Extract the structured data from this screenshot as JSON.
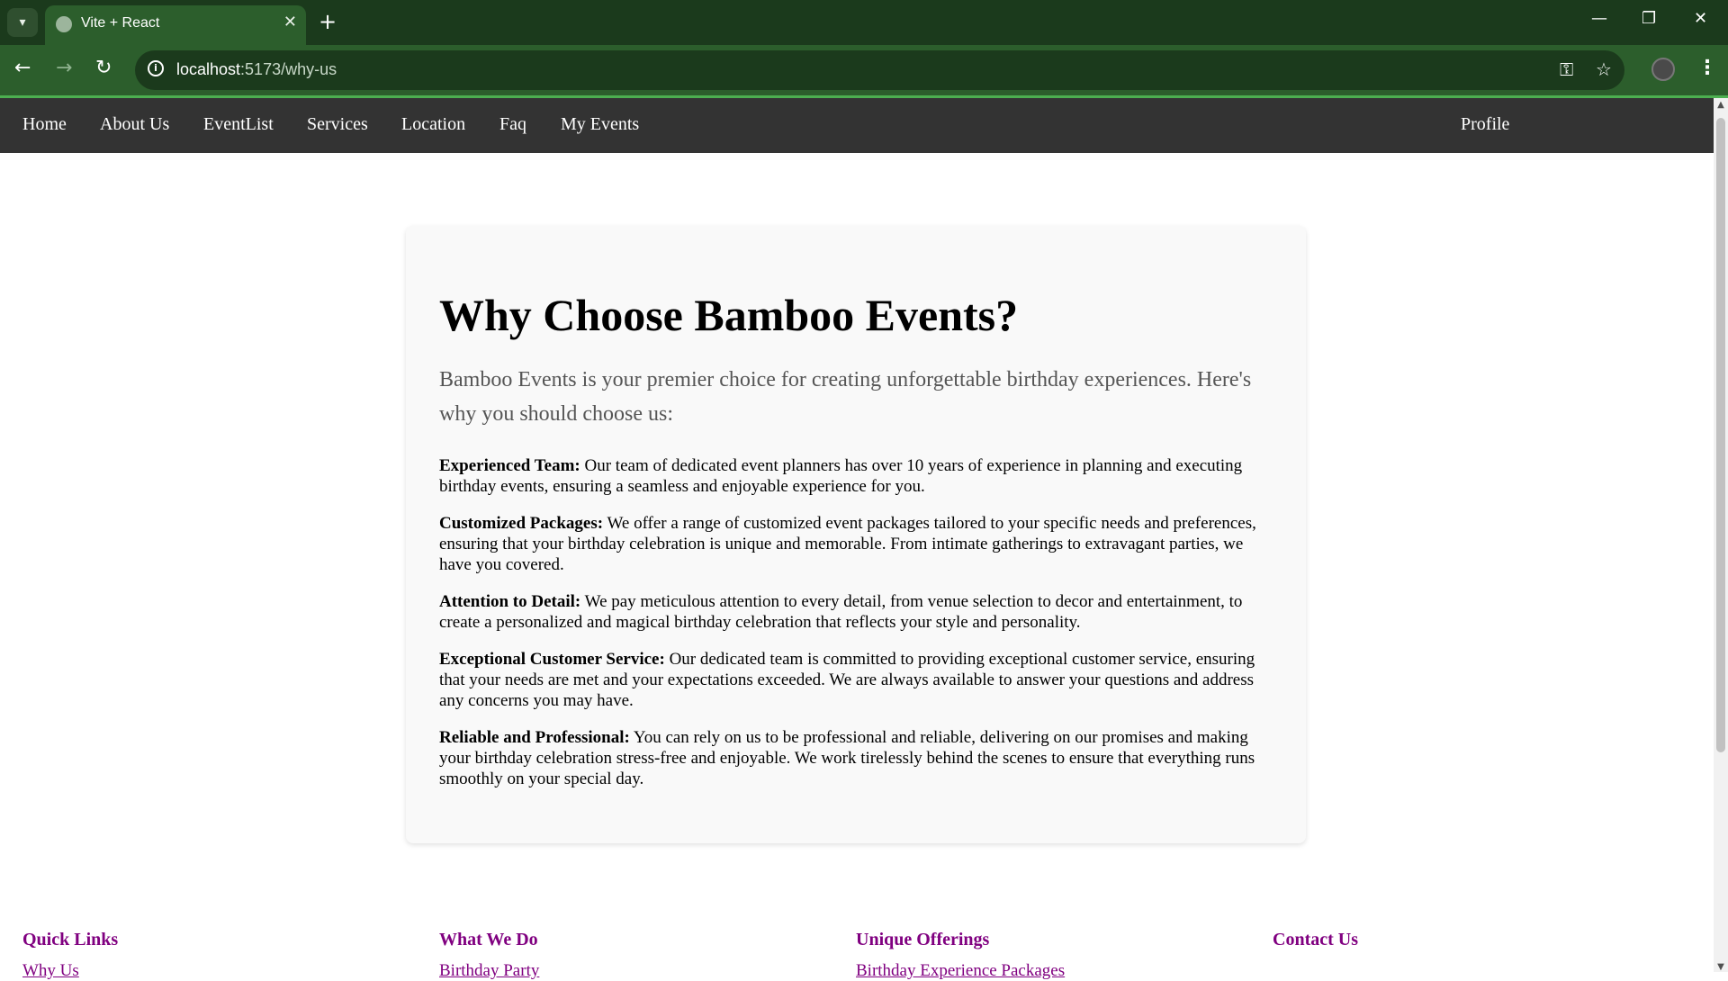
{
  "browser": {
    "tab_title": "Vite + React",
    "url_host": "localhost",
    "url_path": ":5173/why-us",
    "icons": {
      "tab_search": "chevron-down-icon",
      "favicon": "globe-icon",
      "close": "close-icon",
      "new_tab": "plus-icon",
      "minimize": "minimize-icon",
      "restore": "restore-icon",
      "window_close": "close-icon",
      "back": "arrow-left-icon",
      "forward": "arrow-right-icon",
      "reload": "reload-icon",
      "site_info": "info-icon",
      "password": "key-icon",
      "bookmark": "star-icon",
      "menu": "more-vertical-icon"
    }
  },
  "nav": {
    "links": [
      "Home",
      "About Us",
      "EventList",
      "Services",
      "Location",
      "Faq",
      "My Events"
    ],
    "profile": "Profile"
  },
  "main": {
    "heading": "Why Choose Bamboo Events?",
    "intro": "Bamboo Events is your premier choice for creating unforgettable birthday experiences. Here's why you should choose us:",
    "reasons": [
      {
        "title": "Experienced Team:",
        "text": " Our team of dedicated event planners has over 10 years of experience in planning and executing birthday events, ensuring a seamless and enjoyable experience for you."
      },
      {
        "title": "Customized Packages:",
        "text": " We offer a range of customized event packages tailored to your specific needs and preferences, ensuring that your birthday celebration is unique and memorable. From intimate gatherings to extravagant parties, we have you covered."
      },
      {
        "title": "Attention to Detail:",
        "text": " We pay meticulous attention to every detail, from venue selection to decor and entertainment, to create a personalized and magical birthday celebration that reflects your style and personality."
      },
      {
        "title": "Exceptional Customer Service:",
        "text": " Our dedicated team is committed to providing exceptional customer service, ensuring that your needs are met and your expectations exceeded. We are always available to answer your questions and address any concerns you may have."
      },
      {
        "title": "Reliable and Professional:",
        "text": " You can rely on us to be professional and reliable, delivering on our promises and making your birthday celebration stress-free and enjoyable. We work tirelessly behind the scenes to ensure that everything runs smoothly on your special day."
      }
    ]
  },
  "footer": {
    "columns": [
      {
        "title": "Quick Links",
        "first_link": "Why Us"
      },
      {
        "title": "What We Do",
        "first_link": "Birthday Party"
      },
      {
        "title": "Unique Offerings",
        "first_link": "Birthday Experience Packages"
      },
      {
        "title": "Contact Us",
        "first_link": ""
      }
    ]
  },
  "colors": {
    "tabbar": "#1b3a1c",
    "addrbar": "#2c5e2c",
    "nav_bg": "#333333",
    "footer_heading": "#800080"
  }
}
